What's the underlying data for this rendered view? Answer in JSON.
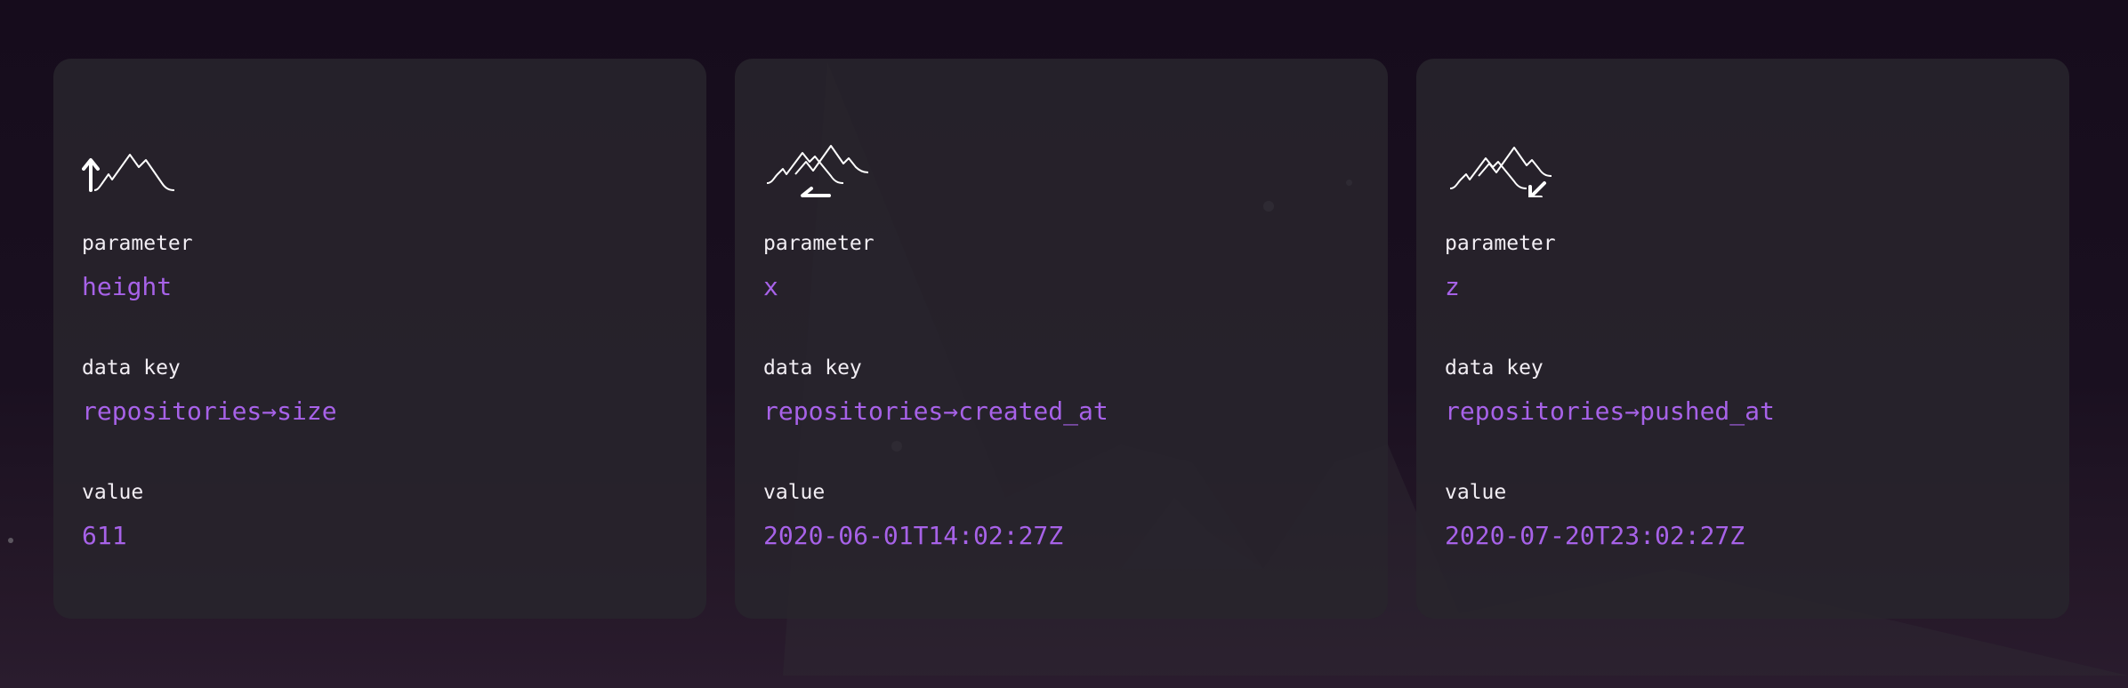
{
  "cards": [
    {
      "icon": "mountain-up-arrow-icon",
      "parameter_label": "parameter",
      "parameter_value": "height",
      "data_key_label": "data key",
      "data_key_value": "repositories→size",
      "value_label": "value",
      "value_value": "611"
    },
    {
      "icon": "mountain-left-arrow-icon",
      "parameter_label": "parameter",
      "parameter_value": "x",
      "data_key_label": "data key",
      "data_key_value": "repositories→created_at",
      "value_label": "value",
      "value_value": "2020-06-01T14:02:27Z"
    },
    {
      "icon": "mountain-down-left-arrow-icon",
      "parameter_label": "parameter",
      "parameter_value": "z",
      "data_key_label": "data key",
      "data_key_value": "repositories→pushed_at",
      "value_label": "value",
      "value_value": "2020-07-20T23:02:27Z"
    }
  ],
  "colors": {
    "background": "#1a1020",
    "card": "#28242c",
    "label": "#f2eef4",
    "accent": "#a762e8"
  }
}
